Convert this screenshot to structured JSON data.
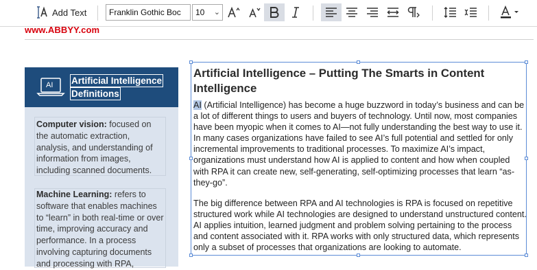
{
  "toolbar": {
    "add_text_label": "Add Text",
    "font_family": "Franklin Gothic Boc",
    "font_size": "10",
    "dropdown_glyph": "⌄"
  },
  "header": {
    "logo_text": "www.ABBYY.com",
    "logo_color": "#d8000c"
  },
  "sidebar": {
    "icon_label": "AI",
    "title_line1": "Artificial Intelligence",
    "title_line2": "Definitions",
    "items": [
      {
        "term": "Computer vision:",
        "definition": " focused on the automatic extraction, analysis, and understanding of information from images, including scanned documents."
      },
      {
        "term": "Machine Learning:",
        "definition": " refers to software that enables machines to “learn” in both real-time or over time, improving accuracy and performance. In a process involving capturing documents and processing with RPA,"
      }
    ],
    "header_color": "#1e4c7c",
    "background_color": "#dbe3ee"
  },
  "article": {
    "title": "Artificial Intelligence – Putting The Smarts in Content Intelligence",
    "selected_word": "AI",
    "para1_rest": " (Artificial Intelligence) has become a huge buzzword in today’s business and can be a lot of different things to users and buyers of technology. Until now, most companies have been myopic when it comes to AI—not fully understanding the best way to use it. In many cases organizations have failed to see AI’s full potential and settled for only incremental improvements to traditional processes. To maximize AI’s impact, organizations must understand how AI is applied to content and how when coupled with RPA it can create new, self-generating, self-optimizing processes that learn “as-they-go”.",
    "para2": "The big difference between RPA and AI technologies is RPA is focused on repetitive structured work while AI technologies are designed to understand unstructured content. AI applies intuition, learned judgment and problem solving pertaining to the process and content associated with it. RPA works with only structured data, which represents only a subset of processes that organizations are looking to automate."
  }
}
